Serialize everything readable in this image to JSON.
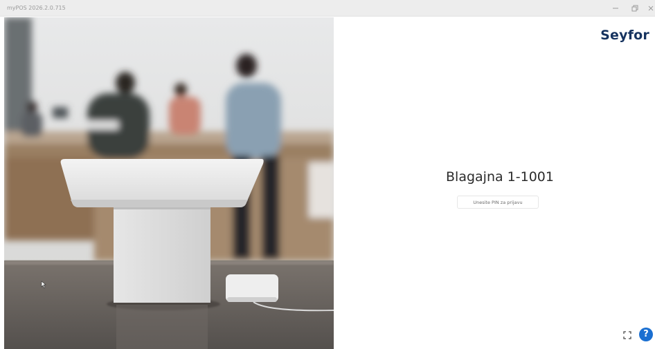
{
  "window": {
    "title": "myPOS 2026.2.0.715",
    "controls": [
      "minimize-icon",
      "maximize-icon",
      "close-icon"
    ]
  },
  "photo": {
    "icon": "pos-terminal-photo"
  },
  "brand": {
    "logo_text": "Seyfor",
    "color": "#16335f"
  },
  "login": {
    "register_name": "Blagajna 1-1001",
    "pin_placeholder": "Unesite PIN za prijavu",
    "pin_value": ""
  },
  "footer": {
    "fullscreen_icon": "fullscreen-icon",
    "help_label": "?",
    "help_color": "#1a6fd1"
  }
}
